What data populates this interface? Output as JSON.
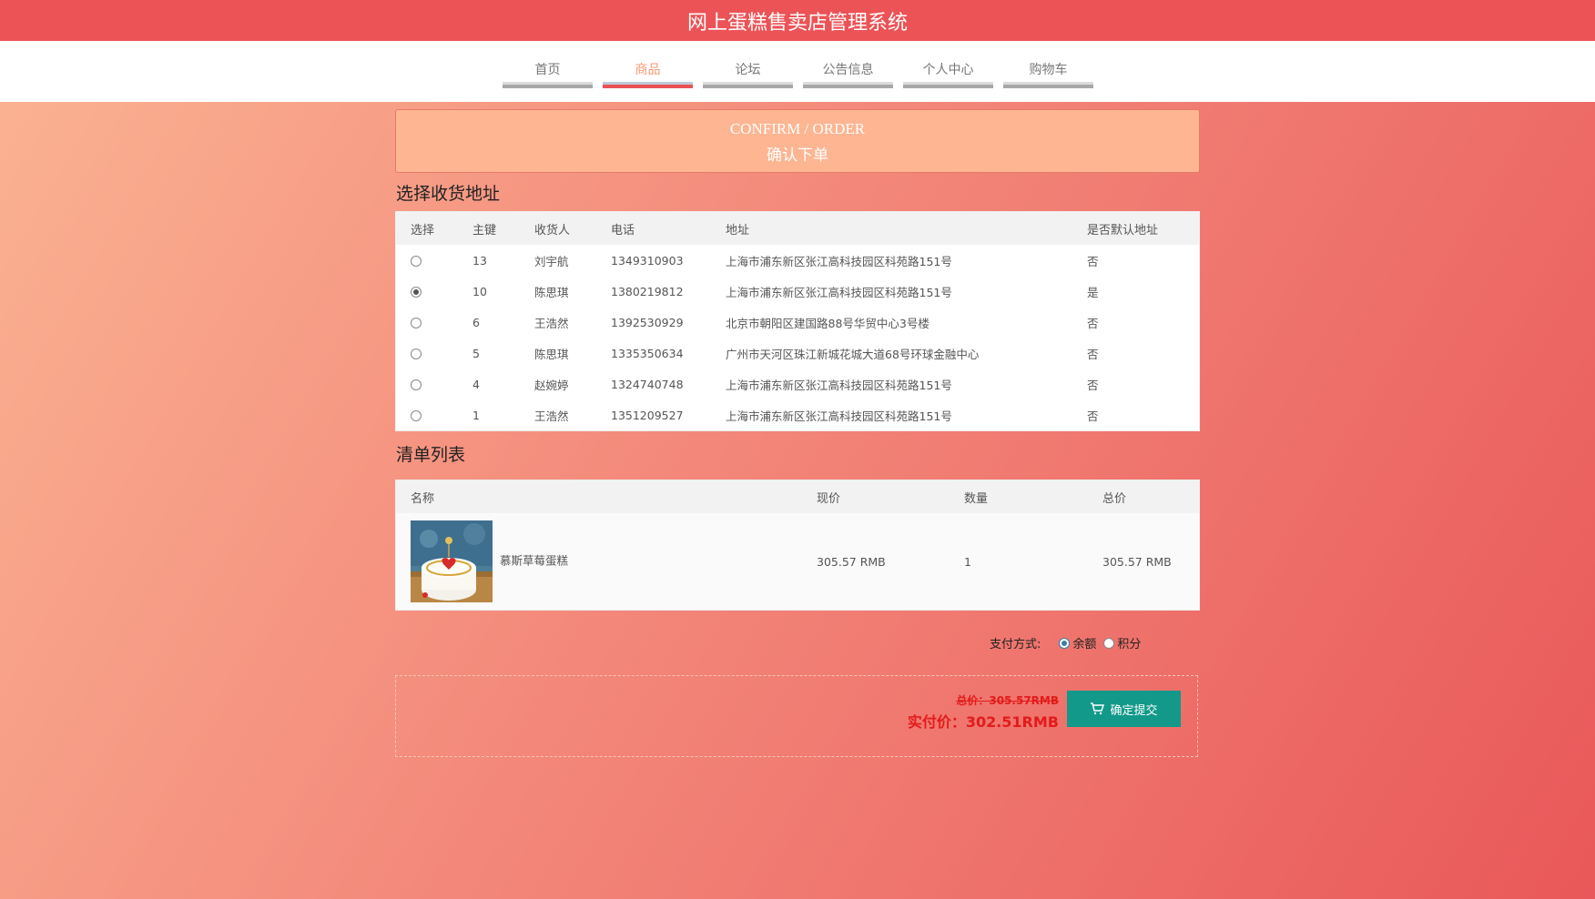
{
  "header": {
    "title": "网上蛋糕售卖店管理系统"
  },
  "nav": [
    {
      "label": "首页",
      "active": false
    },
    {
      "label": "商品",
      "active": true
    },
    {
      "label": "论坛",
      "active": false
    },
    {
      "label": "公告信息",
      "active": false
    },
    {
      "label": "个人中心",
      "active": false
    },
    {
      "label": "购物车",
      "active": false
    }
  ],
  "banner": {
    "en": "CONFIRM / ORDER",
    "cn": "确认下单"
  },
  "address_section": {
    "title": "选择收货地址",
    "columns": [
      "选择",
      "主键",
      "收货人",
      "电话",
      "地址",
      "是否默认地址"
    ],
    "rows": [
      {
        "selected": false,
        "id": "13",
        "name": "刘宇航",
        "phone": "1349310903",
        "address": "上海市浦东新区张江高科技园区科苑路151号",
        "default": "否"
      },
      {
        "selected": true,
        "id": "10",
        "name": "陈思琪",
        "phone": "1380219812",
        "address": "上海市浦东新区张江高科技园区科苑路151号",
        "default": "是"
      },
      {
        "selected": false,
        "id": "6",
        "name": "王浩然",
        "phone": "1392530929",
        "address": "北京市朝阳区建国路88号华贸中心3号楼",
        "default": "否"
      },
      {
        "selected": false,
        "id": "5",
        "name": "陈思琪",
        "phone": "1335350634",
        "address": "广州市天河区珠江新城花城大道68号环球金融中心",
        "default": "否"
      },
      {
        "selected": false,
        "id": "4",
        "name": "赵婉婷",
        "phone": "1324740748",
        "address": "上海市浦东新区张江高科技园区科苑路151号",
        "default": "否"
      },
      {
        "selected": false,
        "id": "1",
        "name": "王浩然",
        "phone": "1351209527",
        "address": "上海市浦东新区张江高科技园区科苑路151号",
        "default": "否"
      }
    ]
  },
  "items_section": {
    "title": "清单列表",
    "columns": [
      "名称",
      "现价",
      "数量",
      "总价"
    ],
    "rows": [
      {
        "name": "慕斯草莓蛋糕",
        "price": "305.57 RMB",
        "qty": "1",
        "total": "305.57 RMB"
      }
    ]
  },
  "payment": {
    "label": "支付方式:",
    "options": [
      {
        "label": "余额",
        "selected": true
      },
      {
        "label": "积分",
        "selected": false
      }
    ]
  },
  "summary": {
    "old_total": "总价：305.57RMB",
    "real_total": "实付价：302.51RMB",
    "submit_label": "确定提交"
  }
}
